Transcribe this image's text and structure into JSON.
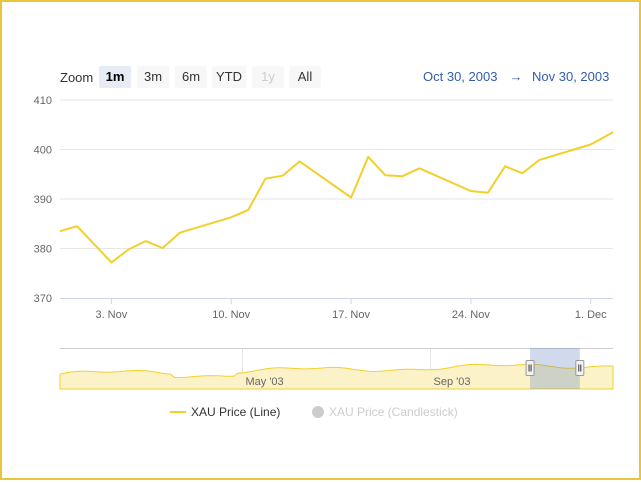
{
  "colors": {
    "series_line": "#f2d02b",
    "series_fill": "#fbf2c8",
    "frame_border": "#e8c53a",
    "date_text": "#335cad",
    "button_bg": "#f7f7f7",
    "button_active_bg": "#e6ebf5",
    "navigator_mask": "#6685c2",
    "legend_inactive": "#cccccc"
  },
  "range_selector": {
    "zoom_label": "Zoom",
    "buttons": [
      {
        "label": "1m",
        "state": "active"
      },
      {
        "label": "3m",
        "state": "normal"
      },
      {
        "label": "6m",
        "state": "normal"
      },
      {
        "label": "YTD",
        "state": "normal"
      },
      {
        "label": "1y",
        "state": "disabled"
      },
      {
        "label": "All",
        "state": "normal"
      }
    ],
    "from_date": "Oct 30, 2003",
    "arrow": "→",
    "to_date": "Nov 30, 2003"
  },
  "navigator": {
    "labels": [
      "May '03",
      "Sep '03"
    ],
    "window_start_fraction": 0.85,
    "window_end_fraction": 0.94
  },
  "legend": {
    "items": [
      {
        "name": "XAU Price (Line)",
        "active": true
      },
      {
        "name": "XAU Price (Candlestick)",
        "active": false
      }
    ]
  },
  "chart_data": {
    "type": "line",
    "title": "",
    "xlabel": "",
    "ylabel": "",
    "ylim": [
      370,
      410
    ],
    "yticks": [
      370,
      380,
      390,
      400,
      410
    ],
    "xticks": [
      {
        "day": 3,
        "label": "3. Nov"
      },
      {
        "day": 10,
        "label": "10. Nov"
      },
      {
        "day": 17,
        "label": "17. Nov"
      },
      {
        "day": 24,
        "label": "24. Nov"
      },
      {
        "day": 31,
        "label": "1. Dec"
      }
    ],
    "xlim_days": [
      0,
      32.3
    ],
    "grid": "horizontal",
    "legend_position": "bottom",
    "series": [
      {
        "name": "XAU Price (Line)",
        "x_days": [
          0,
          1,
          3,
          4,
          5,
          6,
          7,
          10,
          11,
          12,
          13,
          14,
          17,
          18,
          19,
          20,
          21,
          24,
          25,
          26,
          27,
          28,
          31,
          32.3
        ],
        "y": [
          383.5,
          384.5,
          377.2,
          379.8,
          381.5,
          380.1,
          383.2,
          386.3,
          387.8,
          394.1,
          394.7,
          397.6,
          390.3,
          398.5,
          394.8,
          394.6,
          396.2,
          391.6,
          391.3,
          396.6,
          395.2,
          397.9,
          401.0,
          403.5
        ]
      }
    ]
  }
}
